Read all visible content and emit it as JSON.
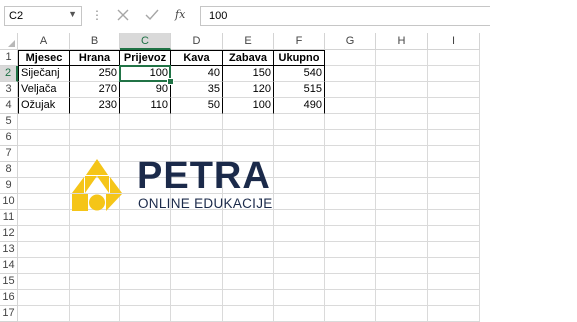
{
  "formula_bar": {
    "name_box": "C2",
    "cancel_icon": "close-icon",
    "enter_icon": "checkmark-icon",
    "function_label": "fx",
    "value": "100"
  },
  "columns": [
    "A",
    "B",
    "C",
    "D",
    "E",
    "F",
    "G",
    "H",
    "I"
  ],
  "rows": [
    "1",
    "2",
    "3",
    "4",
    "5",
    "6",
    "7",
    "8",
    "9",
    "10",
    "11",
    "12",
    "13",
    "14",
    "15",
    "16",
    "17"
  ],
  "selected_cell": "C2",
  "table": {
    "headers": [
      "Mjesec",
      "Hrana",
      "Prijevoz",
      "Kava",
      "Zabava",
      "Ukupno"
    ],
    "rows": [
      [
        "Siječanj",
        "250",
        "100",
        "40",
        "150",
        "540"
      ],
      [
        "Veljača",
        "270",
        "90",
        "35",
        "120",
        "515"
      ],
      [
        "Ožujak",
        "230",
        "110",
        "50",
        "100",
        "490"
      ]
    ]
  },
  "logo": {
    "brand": "PETRA",
    "tagline": "ONLINE EDUKACIJE",
    "colors": {
      "yellow": "#f5c518",
      "navy": "#1b2a4a"
    }
  },
  "colors": {
    "accent": "#217346"
  }
}
